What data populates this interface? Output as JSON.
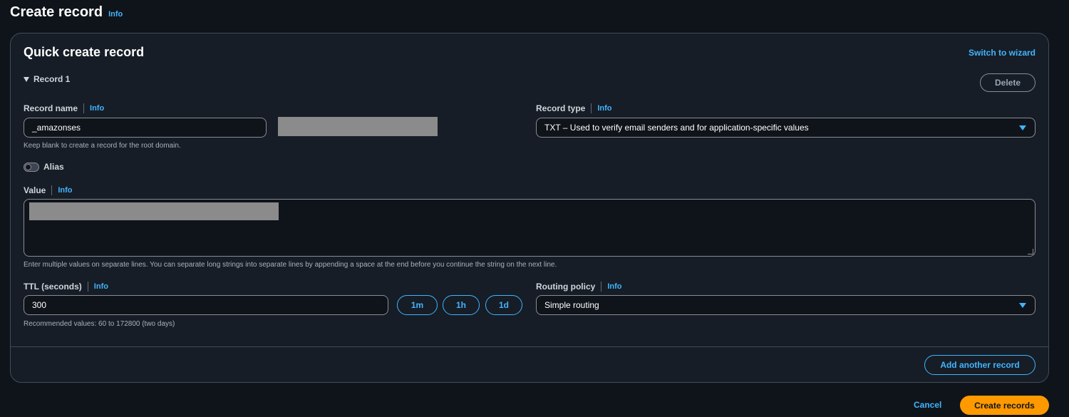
{
  "page": {
    "title": "Create record",
    "info": "Info"
  },
  "panel": {
    "title": "Quick create record",
    "switch_to_wizard": "Switch to wizard",
    "record_label": "Record 1",
    "delete_label": "Delete"
  },
  "record_name": {
    "label": "Record name",
    "info": "Info",
    "value": "_amazonses",
    "hint": "Keep blank to create a record for the root domain."
  },
  "record_type": {
    "label": "Record type",
    "info": "Info",
    "selected": "TXT – Used to verify email senders and for application-specific values"
  },
  "alias": {
    "label": "Alias",
    "enabled": false
  },
  "value": {
    "label": "Value",
    "info": "Info",
    "hint": "Enter multiple values on separate lines. You can separate long strings into separate lines by appending a space at the end before you continue the string on the next line."
  },
  "ttl": {
    "label": "TTL (seconds)",
    "info": "Info",
    "value": "300",
    "hint": "Recommended values: 60 to 172800 (two days)",
    "presets": [
      "1m",
      "1h",
      "1d"
    ]
  },
  "routing_policy": {
    "label": "Routing policy",
    "info": "Info",
    "selected": "Simple routing"
  },
  "actions": {
    "add_another": "Add another record",
    "cancel": "Cancel",
    "create": "Create records"
  },
  "colors": {
    "accent": "#42b4ff",
    "primary_button": "#ff9900",
    "panel_bg": "#161d26",
    "page_bg": "#0f141a"
  }
}
